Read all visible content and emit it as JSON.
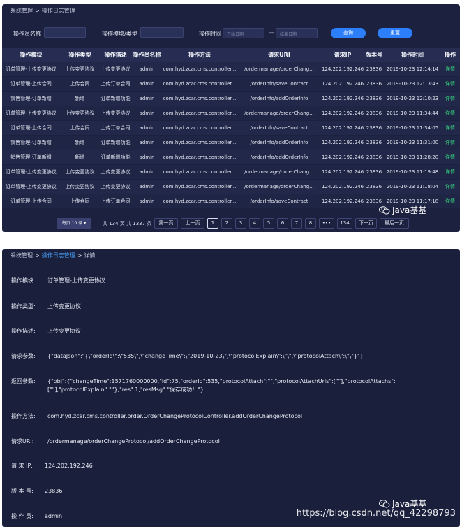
{
  "list": {
    "breadcrumb": [
      "系统管理",
      "操作日志管理"
    ],
    "breadcrumb_sep": ">",
    "filters": {
      "operator_label": "操作员名称",
      "module_label": "操作模块/类型",
      "time_label": "操作时间",
      "start_placeholder": "开始日期",
      "date_sep": "—",
      "end_placeholder": "结束日期",
      "query_button": "查询",
      "reset_button": "重置"
    },
    "columns": [
      "操作模块",
      "操作类型",
      "操作描述",
      "操作员名称",
      "操作方法",
      "请求URI",
      "请求IP",
      "版本号",
      "操作时间",
      "操作"
    ],
    "rows": [
      [
        "订单管理-上传变更协议",
        "上传变更协议",
        "上传变更协议",
        "admin",
        "com.hyd.zcar.cms.controller...",
        "/ordermanage/orderChang...",
        "124.202.192.246",
        "23836",
        "2019-10-23 12:14:14",
        "详情"
      ],
      [
        "订单管理-上传合同",
        "上传合同",
        "上传订单合同",
        "admin",
        "com.hyd.zcar.cms.controller...",
        "/orderInfo/saveContract",
        "124.202.192.246",
        "23836",
        "2019-10-23 12:13:43",
        "详情"
      ],
      [
        "销售管理-订单新增",
        "新增",
        "订单新增功能",
        "admin",
        "com.hyd.zcar.cms.controller...",
        "/orderInfo/addOrderInfo",
        "124.202.192.246",
        "23836",
        "2019-10-23 12:10:23",
        "详情"
      ],
      [
        "订单管理-上传变更协议",
        "上传变更协议",
        "上传变更协议",
        "admin",
        "com.hyd.zcar.cms.controller...",
        "/ordermanage/orderChang...",
        "124.202.192.246",
        "23836",
        "2019-10-23 11:34:44",
        "详情"
      ],
      [
        "订单管理-上传合同",
        "上传合同",
        "上传订单合同",
        "admin",
        "com.hyd.zcar.cms.controller...",
        "/orderInfo/saveContract",
        "124.202.192.246",
        "23836",
        "2019-10-23 11:34:05",
        "详情"
      ],
      [
        "销售管理-订单新增",
        "新增",
        "订单新增功能",
        "admin",
        "com.hyd.zcar.cms.controller...",
        "/orderInfo/addOrderInfo",
        "124.202.192.246",
        "23836",
        "2019-10-23 11:31:00",
        "详情"
      ],
      [
        "销售管理-订单新增",
        "新增",
        "订单新增功能",
        "admin",
        "com.hyd.zcar.cms.controller...",
        "/orderInfo/addOrderInfo",
        "124.202.192.246",
        "23836",
        "2019-10-23 11:28:20",
        "详情"
      ],
      [
        "订单管理-上传变更协议",
        "上传变更协议",
        "上传变更协议",
        "admin",
        "com.hyd.zcar.cms.controller...",
        "/ordermanage/orderChang...",
        "124.202.192.246",
        "23836",
        "2019-10-23 11:19:48",
        "详情"
      ],
      [
        "订单管理-上传变更协议",
        "上传变更协议",
        "上传变更协议",
        "admin",
        "com.hyd.zcar.cms.controller...",
        "/ordermanage/orderChang...",
        "124.202.192.246",
        "23836",
        "2019-10-23 11:18:04",
        "详情"
      ],
      [
        "订单管理-上传合同",
        "上传合同",
        "上传订单合同",
        "admin",
        "com.hyd.zcar.cms.controller...",
        "/orderInfo/saveContract",
        "124.202.192.246",
        "23836",
        "2019-10-23 11:17:18",
        "详情"
      ]
    ],
    "pager": {
      "page_size": "每页 10 条",
      "total": "共 134 页 共 1337 条",
      "first": "第一页",
      "prev": "上一页",
      "pages": [
        "1",
        "2",
        "3",
        "4",
        "5",
        "6",
        "7",
        "8",
        "•••",
        "134"
      ],
      "current_page": "1",
      "next": "下一页",
      "last": "最后一页"
    },
    "watermark": "Java基基"
  },
  "detail": {
    "breadcrumb": [
      "系统管理",
      "操作日志管理",
      "详情"
    ],
    "breadcrumb_sep": ">",
    "fields": [
      {
        "label": "操作模块:",
        "value": "订单管理-上传变更协议"
      },
      {
        "label": "操作类型:",
        "value": "上传变更协议"
      },
      {
        "label": "操作描述:",
        "value": "上传变更协议"
      },
      {
        "label": "请求参数:",
        "value": "{\"dataJson\":\"{\\\"orderId\\\":\\\"535\\\",\\\"changeTime\\\":\\\"2019-10-23\\\",\\\"protocolExplain\\\":\\\"\\\",\\\"protocolAttach\\\":\\\"\\\"}\"}"
      },
      {
        "label": "返回参数:",
        "value": "{\"obj\":{\"changeTime\":1571760000000,\"id\":75,\"orderId\":535,\"protocolAttach\":\"\",\"protocolAttachUrls\":[\"\"],\"protocolAttachs\":[\"\"],\"protocolExplain\":\"\"},\"res\":1,\"resMsg\":\"保存成功！\"}"
      },
      {
        "label": "操作方法:",
        "value": "com.hyd.zcar.cms.controller.order.OrderChangeProtocolController.addOrderChangeProtocol"
      },
      {
        "label": "请求URI:",
        "value": "/ordermanage/orderChangeProtocol/addOrderChangeProtocol"
      },
      {
        "label": "请 求 IP:",
        "value": "124.202.192.246"
      },
      {
        "label": "版 本 号:",
        "value": "23836"
      },
      {
        "label": "操 作 员:",
        "value": "admin"
      }
    ],
    "watermark": "Java基基",
    "csdn_watermark": "https://blog.csdn.net/qq_42298793"
  }
}
